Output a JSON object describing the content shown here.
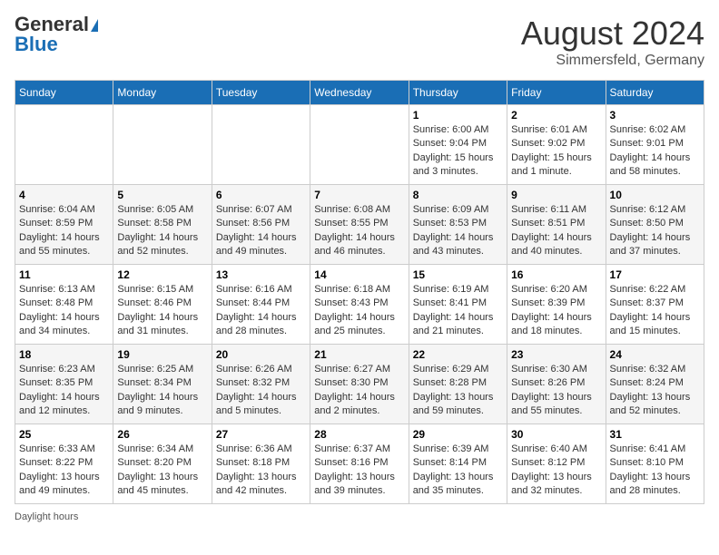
{
  "header": {
    "logo_general": "General",
    "logo_blue": "Blue",
    "month_year": "August 2024",
    "location": "Simmersfeld, Germany"
  },
  "weekdays": [
    "Sunday",
    "Monday",
    "Tuesday",
    "Wednesday",
    "Thursday",
    "Friday",
    "Saturday"
  ],
  "legend": "Daylight hours",
  "weeks": [
    [
      {
        "day": "",
        "sunrise": "",
        "sunset": "",
        "daylight": ""
      },
      {
        "day": "",
        "sunrise": "",
        "sunset": "",
        "daylight": ""
      },
      {
        "day": "",
        "sunrise": "",
        "sunset": "",
        "daylight": ""
      },
      {
        "day": "",
        "sunrise": "",
        "sunset": "",
        "daylight": ""
      },
      {
        "day": "1",
        "sunrise": "6:00 AM",
        "sunset": "9:04 PM",
        "daylight": "15 hours and 3 minutes."
      },
      {
        "day": "2",
        "sunrise": "6:01 AM",
        "sunset": "9:02 PM",
        "daylight": "15 hours and 1 minute."
      },
      {
        "day": "3",
        "sunrise": "6:02 AM",
        "sunset": "9:01 PM",
        "daylight": "14 hours and 58 minutes."
      }
    ],
    [
      {
        "day": "4",
        "sunrise": "6:04 AM",
        "sunset": "8:59 PM",
        "daylight": "14 hours and 55 minutes."
      },
      {
        "day": "5",
        "sunrise": "6:05 AM",
        "sunset": "8:58 PM",
        "daylight": "14 hours and 52 minutes."
      },
      {
        "day": "6",
        "sunrise": "6:07 AM",
        "sunset": "8:56 PM",
        "daylight": "14 hours and 49 minutes."
      },
      {
        "day": "7",
        "sunrise": "6:08 AM",
        "sunset": "8:55 PM",
        "daylight": "14 hours and 46 minutes."
      },
      {
        "day": "8",
        "sunrise": "6:09 AM",
        "sunset": "8:53 PM",
        "daylight": "14 hours and 43 minutes."
      },
      {
        "day": "9",
        "sunrise": "6:11 AM",
        "sunset": "8:51 PM",
        "daylight": "14 hours and 40 minutes."
      },
      {
        "day": "10",
        "sunrise": "6:12 AM",
        "sunset": "8:50 PM",
        "daylight": "14 hours and 37 minutes."
      }
    ],
    [
      {
        "day": "11",
        "sunrise": "6:13 AM",
        "sunset": "8:48 PM",
        "daylight": "14 hours and 34 minutes."
      },
      {
        "day": "12",
        "sunrise": "6:15 AM",
        "sunset": "8:46 PM",
        "daylight": "14 hours and 31 minutes."
      },
      {
        "day": "13",
        "sunrise": "6:16 AM",
        "sunset": "8:44 PM",
        "daylight": "14 hours and 28 minutes."
      },
      {
        "day": "14",
        "sunrise": "6:18 AM",
        "sunset": "8:43 PM",
        "daylight": "14 hours and 25 minutes."
      },
      {
        "day": "15",
        "sunrise": "6:19 AM",
        "sunset": "8:41 PM",
        "daylight": "14 hours and 21 minutes."
      },
      {
        "day": "16",
        "sunrise": "6:20 AM",
        "sunset": "8:39 PM",
        "daylight": "14 hours and 18 minutes."
      },
      {
        "day": "17",
        "sunrise": "6:22 AM",
        "sunset": "8:37 PM",
        "daylight": "14 hours and 15 minutes."
      }
    ],
    [
      {
        "day": "18",
        "sunrise": "6:23 AM",
        "sunset": "8:35 PM",
        "daylight": "14 hours and 12 minutes."
      },
      {
        "day": "19",
        "sunrise": "6:25 AM",
        "sunset": "8:34 PM",
        "daylight": "14 hours and 9 minutes."
      },
      {
        "day": "20",
        "sunrise": "6:26 AM",
        "sunset": "8:32 PM",
        "daylight": "14 hours and 5 minutes."
      },
      {
        "day": "21",
        "sunrise": "6:27 AM",
        "sunset": "8:30 PM",
        "daylight": "14 hours and 2 minutes."
      },
      {
        "day": "22",
        "sunrise": "6:29 AM",
        "sunset": "8:28 PM",
        "daylight": "13 hours and 59 minutes."
      },
      {
        "day": "23",
        "sunrise": "6:30 AM",
        "sunset": "8:26 PM",
        "daylight": "13 hours and 55 minutes."
      },
      {
        "day": "24",
        "sunrise": "6:32 AM",
        "sunset": "8:24 PM",
        "daylight": "13 hours and 52 minutes."
      }
    ],
    [
      {
        "day": "25",
        "sunrise": "6:33 AM",
        "sunset": "8:22 PM",
        "daylight": "13 hours and 49 minutes."
      },
      {
        "day": "26",
        "sunrise": "6:34 AM",
        "sunset": "8:20 PM",
        "daylight": "13 hours and 45 minutes."
      },
      {
        "day": "27",
        "sunrise": "6:36 AM",
        "sunset": "8:18 PM",
        "daylight": "13 hours and 42 minutes."
      },
      {
        "day": "28",
        "sunrise": "6:37 AM",
        "sunset": "8:16 PM",
        "daylight": "13 hours and 39 minutes."
      },
      {
        "day": "29",
        "sunrise": "6:39 AM",
        "sunset": "8:14 PM",
        "daylight": "13 hours and 35 minutes."
      },
      {
        "day": "30",
        "sunrise": "6:40 AM",
        "sunset": "8:12 PM",
        "daylight": "13 hours and 32 minutes."
      },
      {
        "day": "31",
        "sunrise": "6:41 AM",
        "sunset": "8:10 PM",
        "daylight": "13 hours and 28 minutes."
      }
    ]
  ]
}
